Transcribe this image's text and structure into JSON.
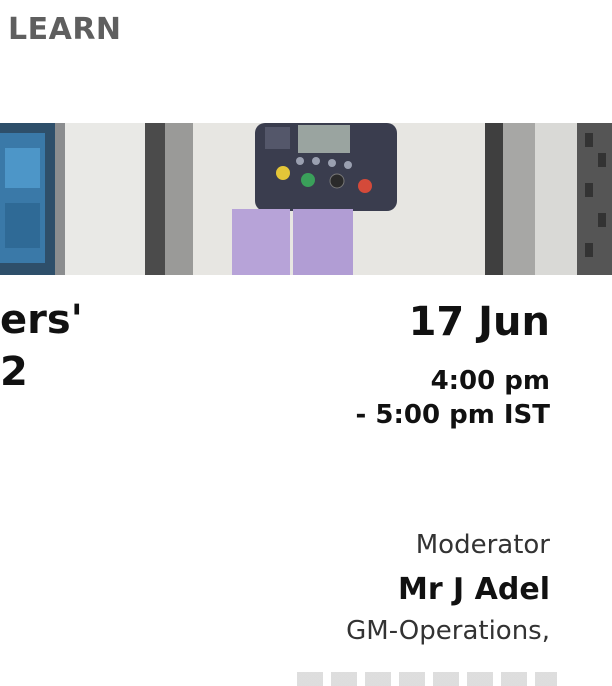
{
  "header": {
    "section_label": "LEARN"
  },
  "event": {
    "title_fragment_line1": "ers'",
    "title_fragment_line2": "2",
    "date": "17 Jun",
    "time_start": "4:00 pm",
    "time_end": "- 5:00 pm IST"
  },
  "moderator": {
    "label": "Moderator",
    "name": "Mr J Adel",
    "role": "GM-Operations,"
  },
  "colors": {
    "learn_text": "#5f5f5f",
    "panel_purple": "#b7a3d8",
    "controller_dark": "#3a3d4e"
  }
}
